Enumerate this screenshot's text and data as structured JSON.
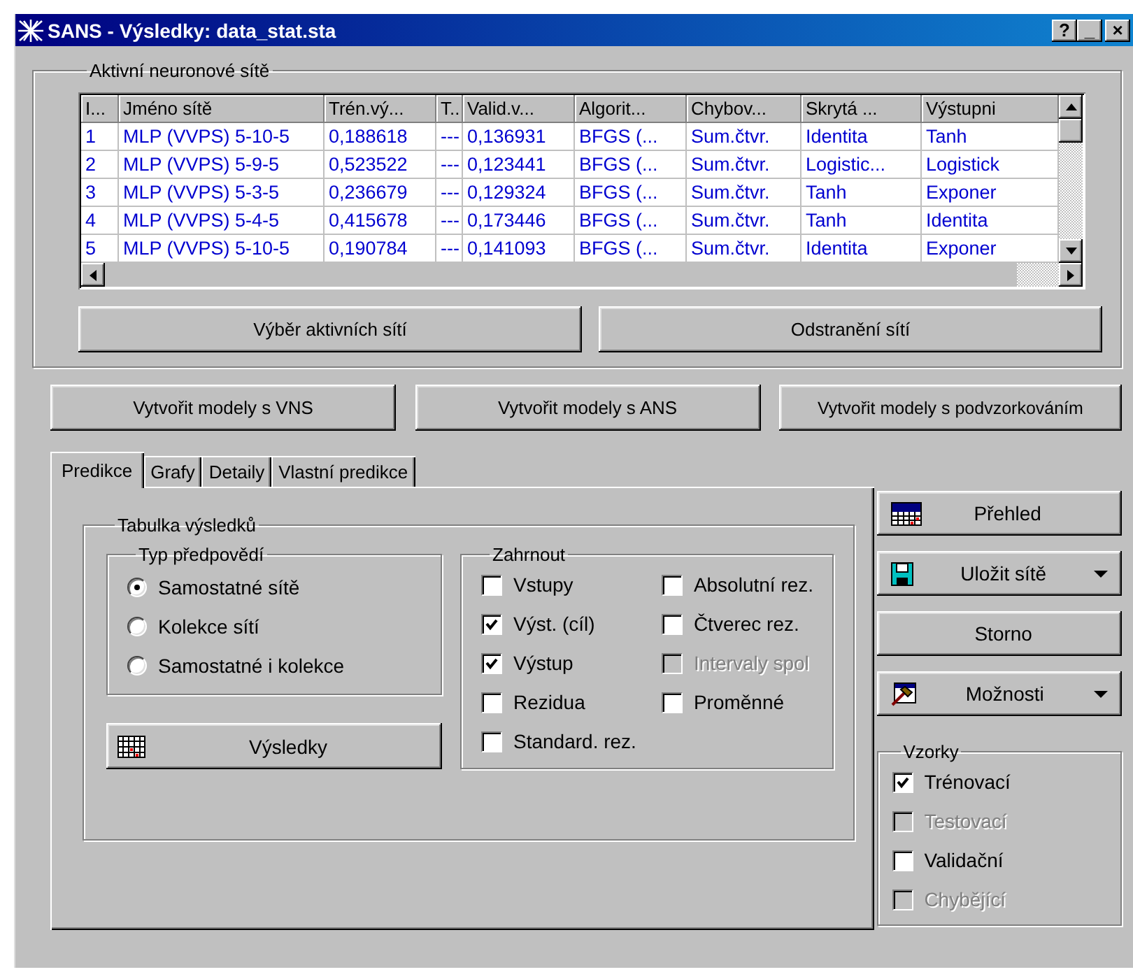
{
  "window": {
    "title": "SANS - Výsledky: data_stat.sta",
    "controls": [
      "?",
      "_",
      "×"
    ]
  },
  "networks_group": {
    "title": "Aktivní neuronové sítě",
    "table": {
      "columns": [
        "I...",
        "Jméno sítě",
        "Trén.vý...",
        "T..",
        "Valid.v...",
        "Algorit...",
        "Chybov...",
        "Skrytá ...",
        "Výstupni"
      ],
      "rows": [
        [
          "1",
          "MLP (VVPS) 5-10-5",
          "0,188618",
          "---",
          "0,136931",
          "BFGS (...",
          "Sum.čtvr.",
          "Identita",
          "Tanh"
        ],
        [
          "2",
          "MLP (VVPS) 5-9-5",
          "0,523522",
          "---",
          "0,123441",
          "BFGS (...",
          "Sum.čtvr.",
          "Logistic...",
          "Logistick"
        ],
        [
          "3",
          "MLP (VVPS) 5-3-5",
          "0,236679",
          "---",
          "0,129324",
          "BFGS (...",
          "Sum.čtvr.",
          "Tanh",
          "Exponer"
        ],
        [
          "4",
          "MLP (VVPS) 5-4-5",
          "0,415678",
          "---",
          "0,173446",
          "BFGS (...",
          "Sum.čtvr.",
          "Tanh",
          "Identita"
        ],
        [
          "5",
          "MLP (VVPS) 5-10-5",
          "0,190784",
          "---",
          "0,141093",
          "BFGS (...",
          "Sum.čtvr.",
          "Identita",
          "Exponer"
        ]
      ]
    },
    "buttons": [
      "Výběr aktivních sítí",
      "Odstranění sítí"
    ]
  },
  "model_buttons": [
    "Vytvořit modely s VNS",
    "Vytvořit modely s ANS",
    "Vytvořit modely s podvzorkováním"
  ],
  "tabs": [
    {
      "label": "Predikce",
      "selected": true
    },
    {
      "label": "Grafy",
      "selected": false
    },
    {
      "label": "Detaily",
      "selected": false
    },
    {
      "label": "Vlastní predikce",
      "selected": false
    }
  ],
  "results_table": {
    "title": "Tabulka výsledků",
    "prediction_type": {
      "title": "Typ předpovědí",
      "options": [
        {
          "label": "Samostatné sítě",
          "selected": true
        },
        {
          "label": "Kolekce sítí",
          "selected": false
        },
        {
          "label": "Samostatné i kolekce",
          "selected": false
        }
      ]
    },
    "results_button": "Výsledky",
    "include": {
      "title": "Zahrnout",
      "columns": [
        {
          "options": [
            {
              "label": "Vstupy",
              "checked": false,
              "disabled": false
            },
            {
              "label": "Výst. (cíl)",
              "checked": true,
              "disabled": false
            },
            {
              "label": "Výstup",
              "checked": true,
              "disabled": false
            },
            {
              "label": "Rezidua",
              "checked": false,
              "disabled": false
            },
            {
              "label": "Standard. rez.",
              "checked": false,
              "disabled": false
            }
          ]
        },
        {
          "options": [
            {
              "label": "Absolutní rez.",
              "checked": false,
              "disabled": false
            },
            {
              "label": "Čtverec rez.",
              "checked": false,
              "disabled": false
            },
            {
              "label": "Intervaly spol",
              "checked": false,
              "disabled": true
            },
            {
              "label": "Proměnné",
              "checked": false,
              "disabled": false
            }
          ]
        }
      ]
    }
  },
  "side_buttons": [
    {
      "label": "Přehled",
      "kind": "summary",
      "dropdown": false
    },
    {
      "label": "Uložit sítě",
      "kind": "save",
      "dropdown": true
    },
    {
      "label": "Storno",
      "kind": "plain",
      "dropdown": false
    },
    {
      "label": "Možnosti",
      "kind": "options",
      "dropdown": true
    }
  ],
  "samples": {
    "title": "Vzorky",
    "options": [
      {
        "label": "Trénovací",
        "checked": true,
        "disabled": false
      },
      {
        "label": "Testovací",
        "checked": false,
        "disabled": true
      },
      {
        "label": "Validační",
        "checked": false,
        "disabled": false
      },
      {
        "label": "Chybějící",
        "checked": false,
        "disabled": true
      }
    ]
  }
}
